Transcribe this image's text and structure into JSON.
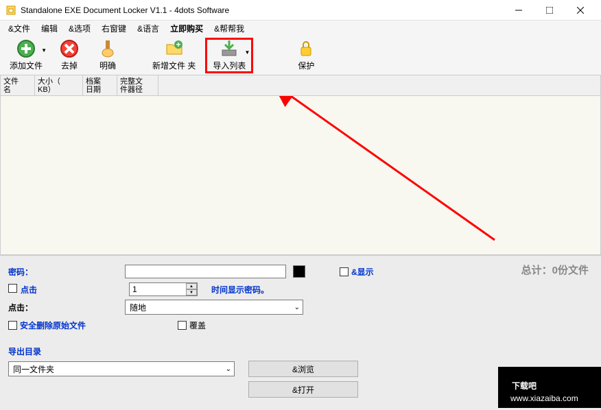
{
  "title": "Standalone EXE Document Locker V1.1 - 4dots Software",
  "menu": {
    "file": "&文件",
    "edit": "编辑",
    "options": "&选项",
    "rightkey": "右窗键",
    "language": "&语言",
    "buy": "立即购买",
    "help": "&帮帮我"
  },
  "toolbar": {
    "add": "添加文件",
    "remove": "去掉",
    "clear": "明确",
    "newfolder": "新增文件 夹",
    "import": "导入列表",
    "protect": "保护"
  },
  "columns": {
    "name": "文件\n名",
    "size": "大小（\nKB）",
    "date": "档案\n日期",
    "path": "完整文\n件器径"
  },
  "form": {
    "password_label": "密码：",
    "click_label": "点击",
    "click_label2": "点击：",
    "time_show": "时间显示密码。",
    "show": "&显示",
    "spinner_value": "1",
    "random": "随地",
    "secure_delete": "安全删除原始文件",
    "overwrite": "覆盖",
    "output_dir": "导出目录",
    "same_folder": "同一文件夹",
    "browse": "&浏览",
    "open": "&打开",
    "total": "总计：0份文件"
  },
  "watermark": {
    "brand": "下载吧",
    "url": "www.xiazaiba.com"
  }
}
